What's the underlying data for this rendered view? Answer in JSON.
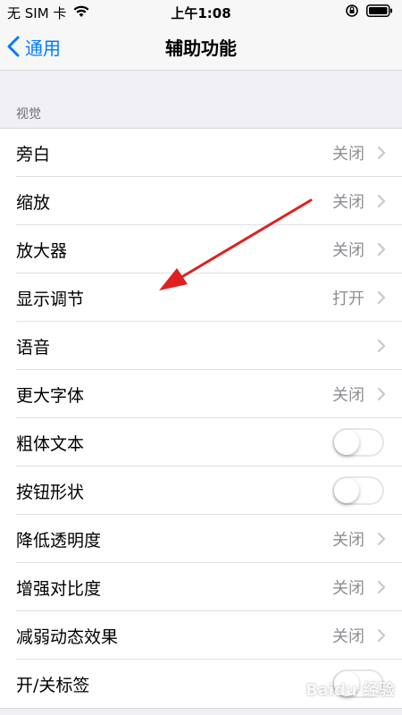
{
  "status_bar": {
    "carrier": "无 SIM 卡",
    "time": "上午1:08"
  },
  "nav": {
    "back_label": "通用",
    "title": "辅助功能"
  },
  "section": {
    "title": "视觉"
  },
  "rows": [
    {
      "label": "旁白",
      "value": "关闭"
    },
    {
      "label": "缩放",
      "value": "关闭"
    },
    {
      "label": "放大器",
      "value": "关闭"
    },
    {
      "label": "显示调节",
      "value": "打开"
    },
    {
      "label": "语音",
      "value": ""
    },
    {
      "label": "更大字体",
      "value": "关闭"
    },
    {
      "label": "粗体文本",
      "toggle": "off"
    },
    {
      "label": "按钮形状",
      "toggle": "off"
    },
    {
      "label": "降低透明度",
      "value": "关闭"
    },
    {
      "label": "增强对比度",
      "value": "关闭"
    },
    {
      "label": "减弱动态效果",
      "value": "关闭"
    },
    {
      "label": "开/关标签",
      "toggle": "off"
    }
  ],
  "watermark": "Baidu 经验",
  "colors": {
    "accent": "#007aff",
    "annotation_arrow": "#e02020",
    "secondary_text": "#8e8e93",
    "background": "#efeff4"
  }
}
